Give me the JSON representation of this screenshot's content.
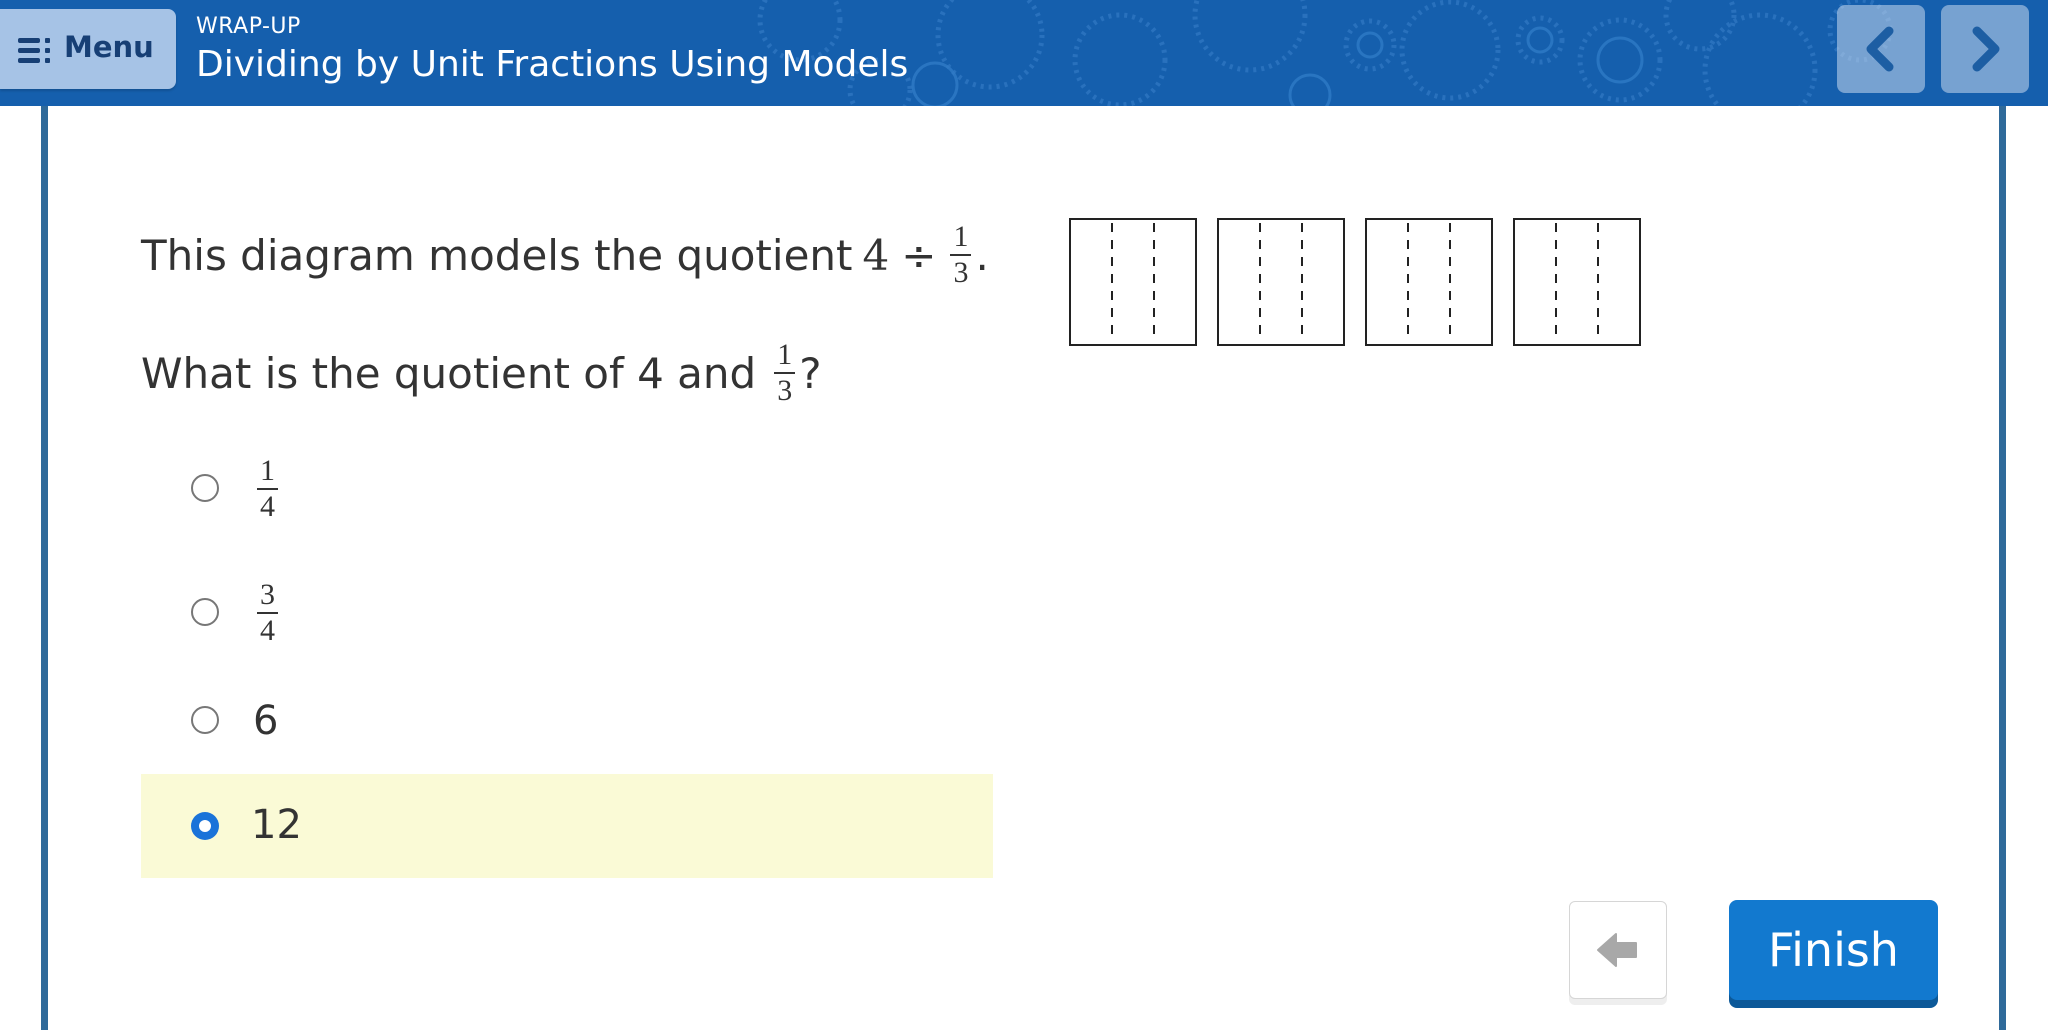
{
  "header": {
    "menu_label": "Menu",
    "kicker": "WRAP-UP",
    "title": "Dividing by Unit Fractions Using Models",
    "background_color": "#155fad"
  },
  "question": {
    "line1_text": "This diagram models the quotient",
    "line1_dividend": "4",
    "line1_operator": "÷",
    "line1_frac_num": "1",
    "line1_frac_den": "3",
    "line1_end": ".",
    "line2_text": "What is the quotient of 4 and",
    "line2_frac_num": "1",
    "line2_frac_den": "3",
    "line2_end": "?"
  },
  "diagram": {
    "wholes": 4,
    "parts_per_whole": 3
  },
  "choices": [
    {
      "num": "1",
      "den": "4",
      "selected": false
    },
    {
      "num": "3",
      "den": "4",
      "selected": false
    },
    {
      "label": "6",
      "selected": false
    },
    {
      "label": "12",
      "selected": true
    }
  ],
  "buttons": {
    "finish_label": "Finish",
    "finish_color": "#1279cf"
  }
}
